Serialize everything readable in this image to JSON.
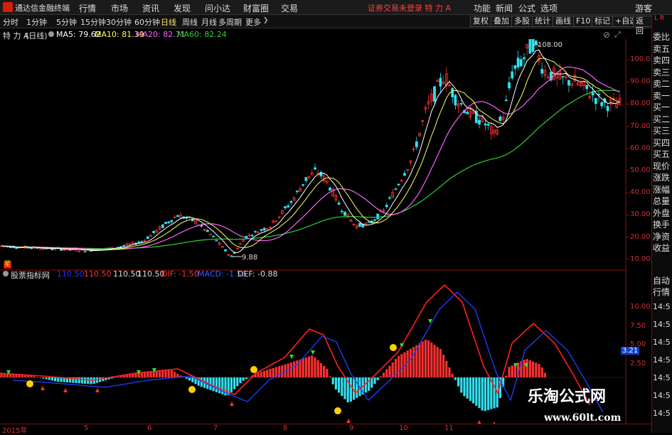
{
  "menubar": {
    "app_title": "通达信金融终端",
    "items": [
      "行情",
      "市场",
      "资讯",
      "发现",
      "问小达",
      "财富圈",
      "交易"
    ],
    "warning": "证券交易未登录 特 力 A",
    "right_items": [
      "功能",
      "新闻",
      "公式",
      "选项"
    ],
    "guest": "游客"
  },
  "toolbar": {
    "periods": [
      "分时",
      "1分钟",
      "5分钟",
      "15分钟",
      "30分钟",
      "60分钟",
      "日线",
      "周线",
      "月线",
      "多周期",
      "更多"
    ],
    "active_period": "日线",
    "right_buttons": [
      "复权",
      "叠加",
      "多股",
      "统计",
      "画线",
      "F10",
      "标记",
      "+自选",
      "返回"
    ]
  },
  "info": {
    "stock": "特 力 A",
    "period_tag": "(日线)",
    "ma5": "MA5: 79.62",
    "ma10": "MA10: 81.39",
    "ma20": "MA20: 82.71",
    "ma60": "MA60: 82.24"
  },
  "price_axis": [
    "100.0",
    "90.00",
    "80.00",
    "70.00",
    "60.00",
    "50.00",
    "40.00",
    "30.00",
    "20.00",
    "10.00"
  ],
  "annotations": {
    "high": "108.00",
    "low": "9.88",
    "marker": "星"
  },
  "indicator": {
    "name": "股票指标网",
    "vals": [
      "110.50",
      "110.50",
      "110.50",
      "110.50"
    ],
    "dif": "DIF: -1.50",
    "macd": "MACD: -1.56",
    "def": "DEF: -0.88",
    "axis": [
      "10.00",
      "7.50",
      "5.00",
      "2.50"
    ],
    "tag": "3.21"
  },
  "dates": [
    "2015年",
    "5",
    "6",
    "7",
    "8",
    "9",
    "10",
    "11"
  ],
  "right_panel": {
    "top_tag": "L R",
    "labels": [
      "委比",
      "卖五",
      "卖四",
      "卖三",
      "卖二",
      "卖一",
      "买一",
      "买二",
      "买三",
      "买四",
      "买五",
      "现价",
      "涨跌",
      "涨幅",
      "总量",
      "外盘",
      "换手",
      "净资",
      "收益"
    ],
    "lower_labels": [
      "自动",
      "行情"
    ],
    "times": [
      "14:5",
      "14:5",
      "14:5",
      "14:5",
      "14:5",
      "14:5",
      "14:5"
    ]
  },
  "watermark": {
    "text": "乐淘公式网",
    "url": "www.60lt.com"
  },
  "colors": {
    "up": "#ff3030",
    "down": "#30e0f0",
    "ma5": "#ffffff",
    "ma10": "#ffff60",
    "ma20": "#ff60ff",
    "ma60": "#30d030",
    "axis": "#8a1010"
  }
}
